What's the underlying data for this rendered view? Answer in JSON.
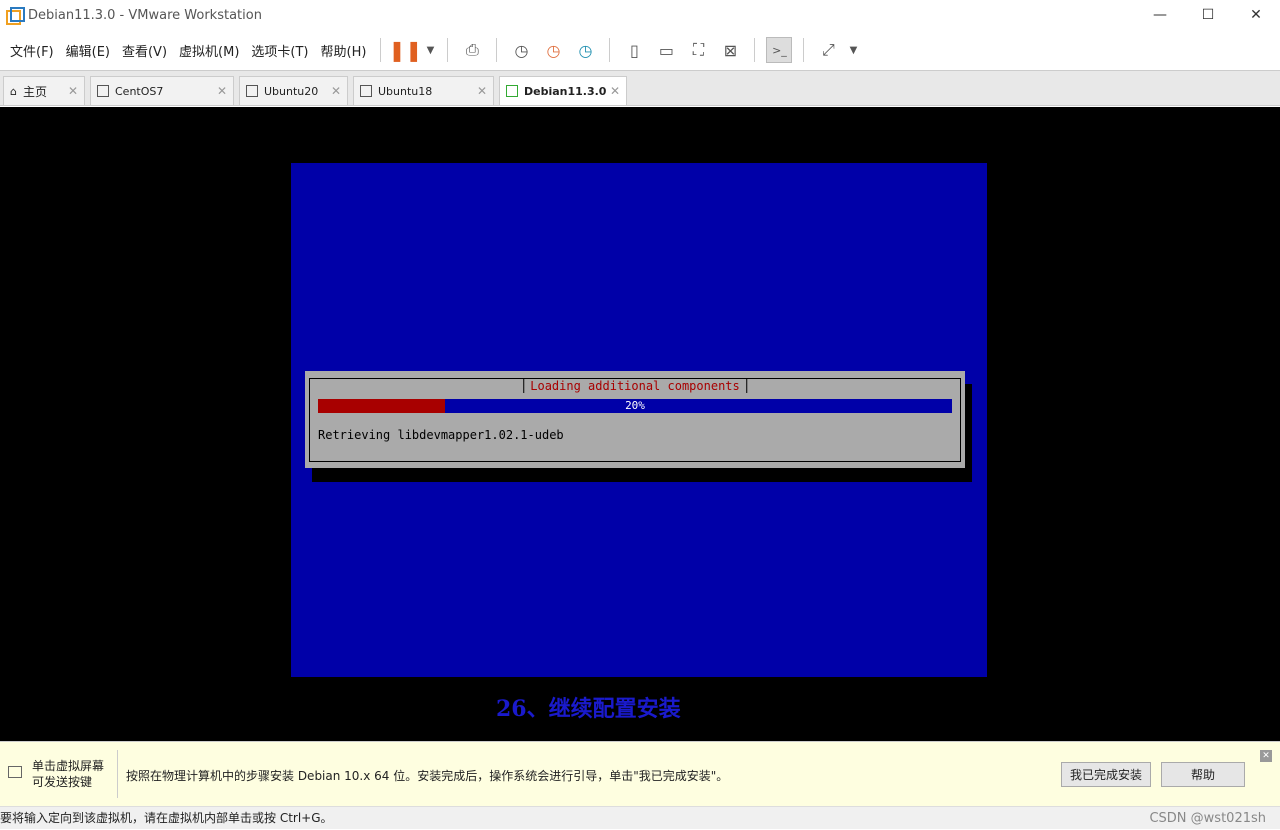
{
  "window": {
    "title": "Debian11.3.0 - VMware Workstation",
    "controls": [
      "—",
      "☐",
      "✕"
    ]
  },
  "menu": [
    "文件(F)",
    "编辑(E)",
    "查看(V)",
    "虚拟机(M)",
    "选项卡(T)",
    "帮助(H)"
  ],
  "toolbar_icons": [
    "pause-icon",
    "dropdown-icon",
    "send-ctrl-alt-del-icon",
    "snapshot-icon",
    "revert-snapshot-icon",
    "snapshot-manager-icon",
    "library-icon",
    "thumbnail-icon",
    "fullscreen-icon",
    "unity-icon",
    "console-icon",
    "stretch-icon"
  ],
  "tabs": [
    {
      "label": "主页"
    },
    {
      "label": "CentOS7"
    },
    {
      "label": "Ubuntu20"
    },
    {
      "label": "Ubuntu18"
    },
    {
      "label": "Debian11.3.0",
      "active": true
    }
  ],
  "installer": {
    "title": "Loading additional components",
    "progress_percent": 20,
    "progress_label": "20%",
    "message": "Retrieving libdevmapper1.02.1-udeb"
  },
  "caption": "26、继续配置安装",
  "hint": {
    "left": "单击虚拟屏幕可发送按键",
    "text": "按照在物理计算机中的步骤安装 Debian 10.x 64 位。安装完成后，操作系统会进行引导，单击\"我已完成安装\"。",
    "done_button": "我已完成安装",
    "help_button": "帮助"
  },
  "status": {
    "text": "要将输入定向到该虚拟机，请在虚拟机内部单击或按 Ctrl+G。",
    "watermark": "CSDN @wst021sh"
  },
  "colors": {
    "installer_bg": "#0000a8",
    "progress_fill": "#a80000",
    "dialog_bg": "#aaaaaa"
  }
}
